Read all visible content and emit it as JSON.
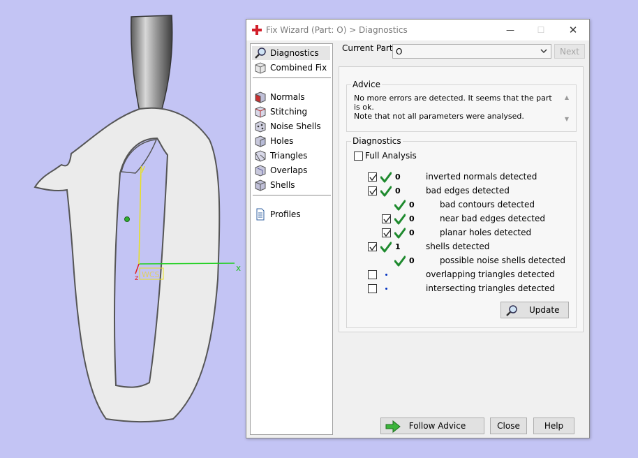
{
  "viewport": {
    "axis_y_label": "y",
    "axis_x_label": "x",
    "axis_z_label": "z",
    "wcs_label": "WCS"
  },
  "dialog": {
    "title": "Fix Wizard (Part: O) > Diagnostics",
    "minimize_glyph": "—",
    "maximize_glyph": "☐",
    "close_glyph": "✕"
  },
  "sidebar": {
    "items": [
      {
        "label": "Diagnostics",
        "icon": "magnifier-icon",
        "selected": true
      },
      {
        "label": "Combined Fix",
        "icon": "cube-icon"
      },
      {
        "label": "Normals",
        "icon": "normals-cube-icon"
      },
      {
        "label": "Stitching",
        "icon": "stitching-cube-icon"
      },
      {
        "label": "Noise Shells",
        "icon": "noise-shells-icon"
      },
      {
        "label": "Holes",
        "icon": "holes-cube-icon"
      },
      {
        "label": "Triangles",
        "icon": "triangles-cube-icon"
      },
      {
        "label": "Overlaps",
        "icon": "overlaps-cube-icon"
      },
      {
        "label": "Shells",
        "icon": "shells-cube-icon"
      },
      {
        "label": "Profiles",
        "icon": "document-icon"
      }
    ]
  },
  "current_part": {
    "label": "Current Part:",
    "value": "O",
    "next_label": "Next"
  },
  "advice": {
    "title": "Advice",
    "text_line1": "No more errors are detected. It seems that the part is ok.",
    "text_line2": "Note that not all parameters were analysed."
  },
  "diagnostics": {
    "title": "Diagnostics",
    "full_analysis_label": "Full Analysis",
    "full_analysis_checked": false,
    "rows": [
      {
        "checkbox": true,
        "checked": true,
        "ok": true,
        "count": "0",
        "text": "inverted normals detected",
        "indent": 0
      },
      {
        "checkbox": true,
        "checked": true,
        "ok": true,
        "count": "0",
        "text": "bad edges detected",
        "indent": 0
      },
      {
        "checkbox": false,
        "ok": true,
        "count": "0",
        "text": "bad contours detected",
        "indent": 1
      },
      {
        "checkbox": true,
        "checked": true,
        "ok": true,
        "count": "0",
        "text": "near bad edges detected",
        "indent": 1
      },
      {
        "checkbox": true,
        "checked": true,
        "ok": true,
        "count": "0",
        "text": "planar holes detected",
        "indent": 1
      },
      {
        "checkbox": true,
        "checked": true,
        "ok": true,
        "count": "1",
        "text": "shells detected",
        "indent": 0
      },
      {
        "checkbox": false,
        "ok": true,
        "count": "0",
        "text": "possible noise shells detected",
        "indent": 1
      },
      {
        "checkbox": true,
        "checked": false,
        "ok": false,
        "count": "",
        "text": "overlapping triangles detected",
        "indent": 0
      },
      {
        "checkbox": true,
        "checked": false,
        "ok": false,
        "count": "",
        "text": "intersecting triangles detected",
        "indent": 0
      }
    ],
    "update_label": "Update"
  },
  "footer": {
    "follow_advice_label": "Follow Advice",
    "close_label": "Close",
    "help_label": "Help"
  },
  "colors": {
    "background": "#c3c4f4",
    "check_green": "#1e8a2e",
    "model_fill": "#ebebeb"
  }
}
